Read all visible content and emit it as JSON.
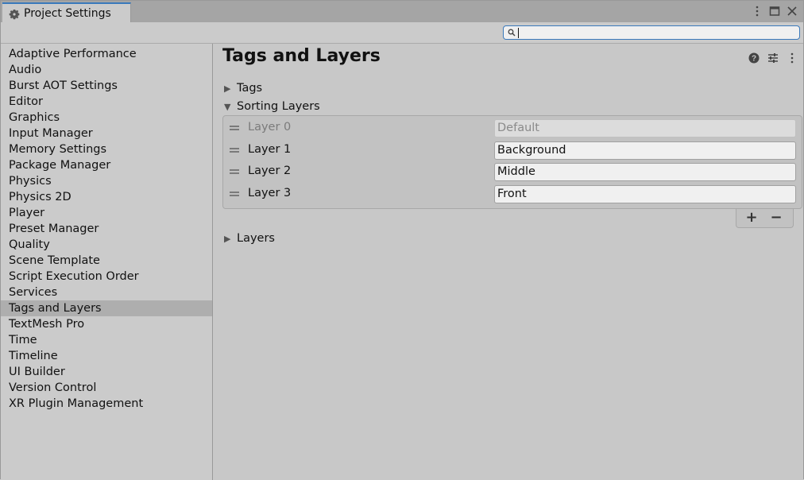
{
  "window": {
    "tab_title": "Project Settings",
    "tab_icon": "gear-icon",
    "buttons": [
      "more-options-icon",
      "maximize-icon",
      "close-icon"
    ]
  },
  "search": {
    "value": "",
    "placeholder": ""
  },
  "sidebar": {
    "items": [
      {
        "label": "Adaptive Performance"
      },
      {
        "label": "Audio"
      },
      {
        "label": "Burst AOT Settings"
      },
      {
        "label": "Editor"
      },
      {
        "label": "Graphics"
      },
      {
        "label": "Input Manager"
      },
      {
        "label": "Memory Settings"
      },
      {
        "label": "Package Manager"
      },
      {
        "label": "Physics"
      },
      {
        "label": "Physics 2D"
      },
      {
        "label": "Player"
      },
      {
        "label": "Preset Manager"
      },
      {
        "label": "Quality"
      },
      {
        "label": "Scene Template"
      },
      {
        "label": "Script Execution Order"
      },
      {
        "label": "Services"
      },
      {
        "label": "Tags and Layers",
        "selected": true
      },
      {
        "label": "TextMesh Pro"
      },
      {
        "label": "Time"
      },
      {
        "label": "Timeline"
      },
      {
        "label": "UI Builder"
      },
      {
        "label": "Version Control"
      },
      {
        "label": "XR Plugin Management"
      }
    ]
  },
  "main": {
    "title": "Tags and Layers",
    "header_icons": [
      "help-icon",
      "preset-sliders-icon",
      "kebab-menu-icon"
    ],
    "sections": {
      "tags": {
        "label": "Tags",
        "expanded": false
      },
      "sorting_layers": {
        "label": "Sorting Layers",
        "expanded": true
      },
      "layers": {
        "label": "Layers",
        "expanded": false
      }
    },
    "sorting_layers": [
      {
        "label": "Layer 0",
        "value": "Default",
        "disabled": true
      },
      {
        "label": "Layer 1",
        "value": "Background",
        "disabled": false
      },
      {
        "label": "Layer 2",
        "value": "Middle",
        "disabled": false
      },
      {
        "label": "Layer 3",
        "value": "Front",
        "disabled": false
      }
    ],
    "add_label": "+",
    "remove_label": "−"
  },
  "colors": {
    "accent": "#3a79bb",
    "selected_row": "#aeaeae",
    "panel_bg": "#c8c8c8"
  }
}
